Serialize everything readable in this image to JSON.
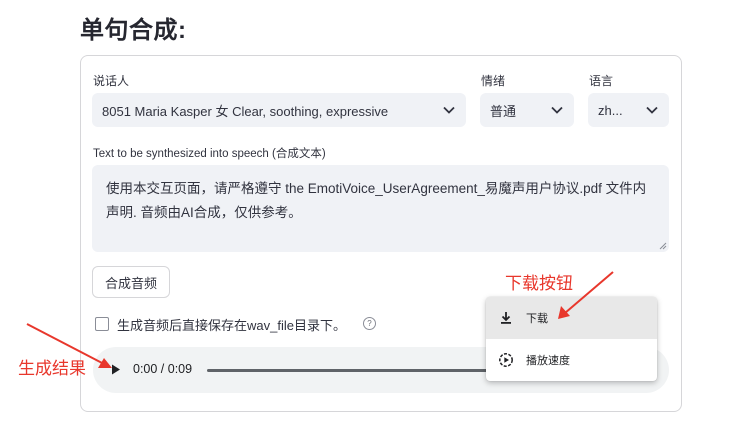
{
  "page": {
    "heading": "单句合成:"
  },
  "form": {
    "speaker": {
      "label": "说话人",
      "value": "8051 Maria Kasper 女 Clear, soothing, expressive"
    },
    "emotion": {
      "label": "情绪",
      "value": "普通"
    },
    "language": {
      "label": "语言",
      "value": "zh..."
    },
    "text_input": {
      "label": "Text to be synthesized into speech (合成文本)",
      "value": "使用本交互页面，请严格遵守 the EmotiVoice_UserAgreement_易魔声用户协议.pdf 文件内声明. 音频由AI合成，仅供参考。"
    },
    "synthesize_button": "合成音频",
    "save_checkbox": {
      "label": "生成音频后直接保存在wav_file目录下。",
      "checked": false
    }
  },
  "audio_player": {
    "time": "0:00 / 0:09"
  },
  "context_menu": {
    "items": [
      {
        "label": "下载",
        "icon": "download-icon"
      },
      {
        "label": "播放速度",
        "icon": "playback-speed-icon"
      }
    ]
  },
  "annotations": {
    "download_button": "下载按钮",
    "result": "生成结果",
    "color": "#e8372c"
  }
}
